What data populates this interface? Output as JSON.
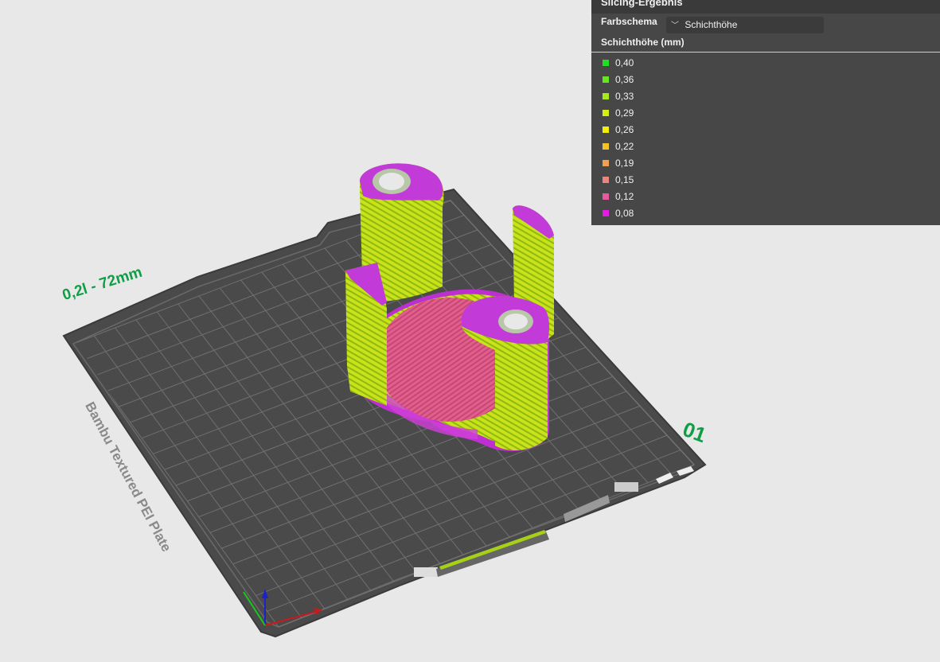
{
  "viewport": {
    "plate_label": "0,2l - 72mm",
    "plate_number": "01",
    "plate_brand": "Bambu Textured PEI Plate"
  },
  "panel": {
    "title": "Slicing-Ergebnis",
    "scheme_label": "Farbschema",
    "scheme_value": "Schichthöhe",
    "legend_title": "Schichthöhe (mm)",
    "legend": [
      {
        "label": "0,40",
        "color": "#22dd22"
      },
      {
        "label": "0,36",
        "color": "#66e61e"
      },
      {
        "label": "0,33",
        "color": "#a6ea1a"
      },
      {
        "label": "0,29",
        "color": "#d6ee12"
      },
      {
        "label": "0,26",
        "color": "#f2ee0c"
      },
      {
        "label": "0,22",
        "color": "#f2c22a"
      },
      {
        "label": "0,19",
        "color": "#f0a050"
      },
      {
        "label": "0,15",
        "color": "#ec8480"
      },
      {
        "label": "0,12",
        "color": "#e85aa0"
      },
      {
        "label": "0,08",
        "color": "#e21ce0"
      }
    ]
  }
}
